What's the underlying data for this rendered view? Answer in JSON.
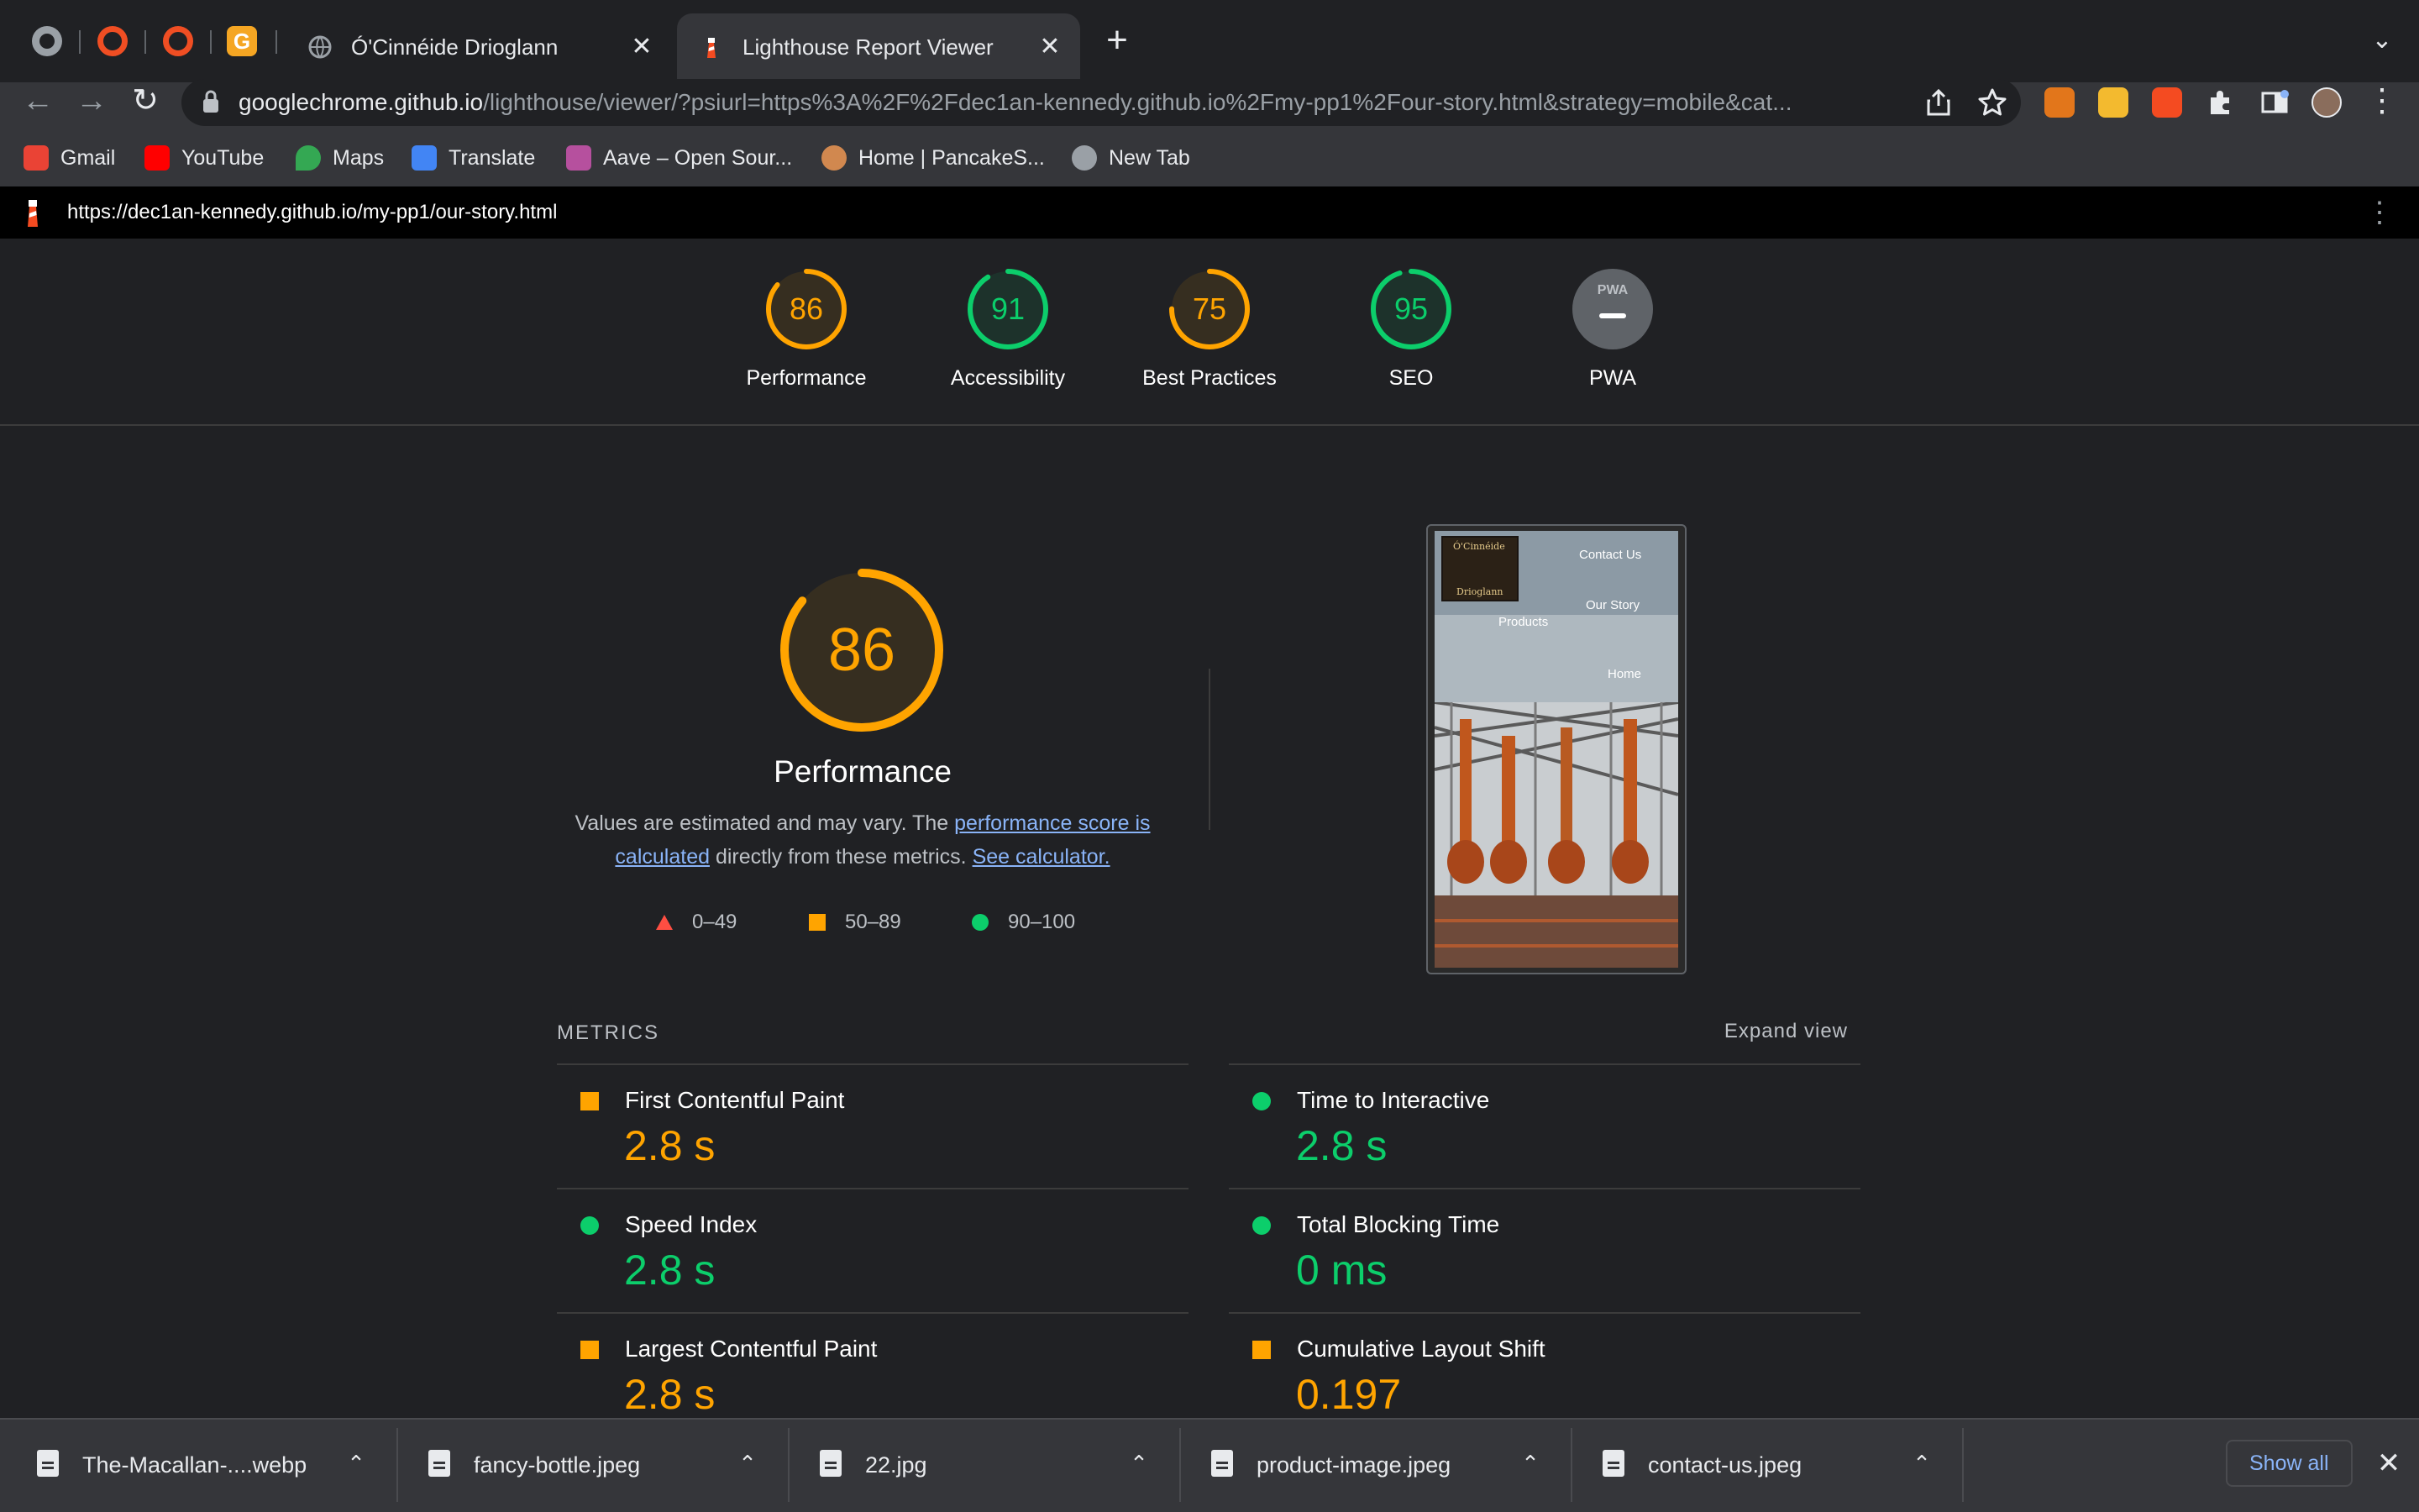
{
  "browser": {
    "tabs": [
      {
        "label": "Ó'Cinnéide Drioglann",
        "active": false
      },
      {
        "label": "Lighthouse Report Viewer",
        "active": true
      }
    ],
    "new_tab_icon": "plus-icon",
    "tab_close_glyph": "✕",
    "address": {
      "host": "googlechrome.github.io",
      "path": "/lighthouse/viewer/?psiurl=https%3A%2F%2Fdec1an-kennedy.github.io%2Fmy-pp1%2Four-story.html&strategy=mobile&cat..."
    },
    "bookmarks": [
      {
        "label": "Gmail",
        "color": "#ea4335"
      },
      {
        "label": "YouTube",
        "color": "#ff0000"
      },
      {
        "label": "Maps",
        "color": "#34a853"
      },
      {
        "label": "Translate",
        "color": "#4285f4"
      },
      {
        "label": "Aave – Open Sour...",
        "color": "#b6509e"
      },
      {
        "label": "Home | PancakeS...",
        "color": "#d1884f"
      },
      {
        "label": "New Tab",
        "color": "#9aa0a6"
      }
    ]
  },
  "report": {
    "url": "https://dec1an-kennedy.github.io/my-pp1/our-story.html",
    "categories": [
      {
        "label": "Performance",
        "score": "86",
        "fraction": 0.86,
        "color": "#ffa400"
      },
      {
        "label": "Accessibility",
        "score": "91",
        "fraction": 0.91,
        "color": "#0cce6b"
      },
      {
        "label": "Best Practices",
        "score": "75",
        "fraction": 0.75,
        "color": "#ffa400"
      },
      {
        "label": "SEO",
        "score": "95",
        "fraction": 0.95,
        "color": "#0cce6b"
      },
      {
        "label": "PWA",
        "score": "",
        "fraction": 0,
        "color": "#5f6368"
      }
    ],
    "pwa_badge_text": "PWA",
    "main": {
      "score": "86",
      "fraction": 0.86,
      "title": "Performance",
      "desc_prefix": "Values are estimated and may vary. The ",
      "desc_link1": "performance score is calculated",
      "desc_middle": " directly from these metrics. ",
      "desc_link2": "See calculator.",
      "legend": [
        {
          "shape": "triangle",
          "label": "0–49",
          "color": "#ff4e42"
        },
        {
          "shape": "square",
          "label": "50–89",
          "color": "#ffa400"
        },
        {
          "shape": "circle",
          "label": "90–100",
          "color": "#0cce6b"
        }
      ]
    },
    "screenshot": {
      "links": [
        "Contact Us",
        "Our Story",
        "Products",
        "Home"
      ],
      "logo_top": "Ó'Cinnéide",
      "logo_bottom": "Drioglann"
    },
    "metrics": {
      "title": "METRICS",
      "expand_label": "Expand view",
      "items": [
        {
          "name": "First Contentful Paint",
          "value": "2.8 s",
          "rating": "average"
        },
        {
          "name": "Time to Interactive",
          "value": "2.8 s",
          "rating": "pass"
        },
        {
          "name": "Speed Index",
          "value": "2.8 s",
          "rating": "pass"
        },
        {
          "name": "Total Blocking Time",
          "value": "0 ms",
          "rating": "pass"
        },
        {
          "name": "Largest Contentful Paint",
          "value": "2.8 s",
          "rating": "average"
        },
        {
          "name": "Cumulative Layout Shift",
          "value": "0.197",
          "rating": "average"
        }
      ]
    }
  },
  "downloads": {
    "files": [
      "The-Macallan-....webp",
      "fancy-bottle.jpeg",
      "22.jpg",
      "product-image.jpeg",
      "contact-us.jpeg"
    ],
    "show_all": "Show all"
  },
  "colors": {
    "orange": "#ffa400",
    "green": "#0cce6b",
    "red": "#ff4e42",
    "link": "#8ab4f8"
  }
}
